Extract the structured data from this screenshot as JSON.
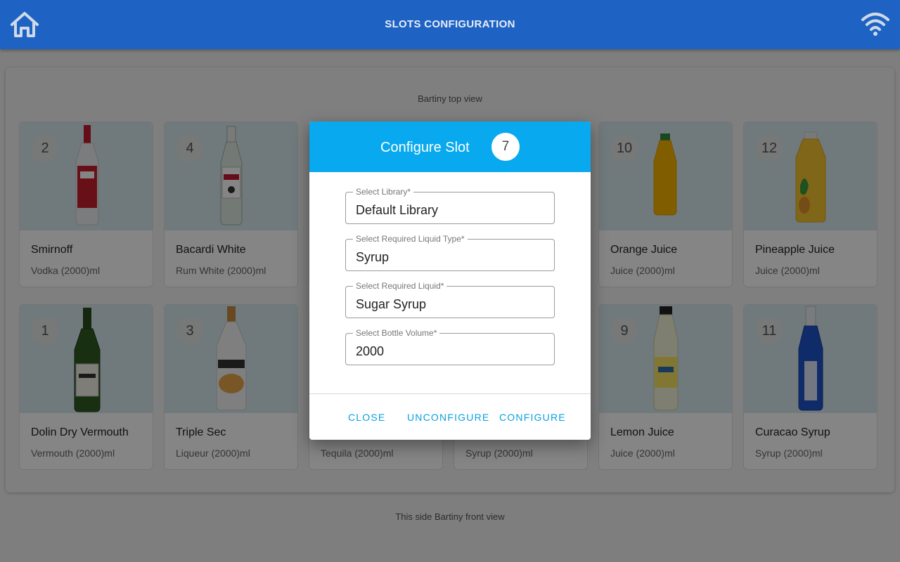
{
  "appbar": {
    "title": "SLOTS CONFIGURATION",
    "home_icon": "home-icon",
    "wifi_icon": "wifi-icon",
    "color": "#1e63c4"
  },
  "captions": {
    "top": "Bartiny top view",
    "bottom": "This side Bartiny front view"
  },
  "slots": [
    {
      "number": "2",
      "name": "Smirnoff",
      "detail": "Vodka (2000)ml",
      "bottle": "smirnoff"
    },
    {
      "number": "4",
      "name": "Bacardi White",
      "detail": "Rum White (2000)ml",
      "bottle": "bacardi"
    },
    {
      "number": "10",
      "name": "Orange Juice",
      "detail": "Juice (2000)ml",
      "bottle": "orange"
    },
    {
      "number": "12",
      "name": "Pineapple Juice",
      "detail": "Juice (2000)ml",
      "bottle": "pineapple"
    },
    {
      "number": "1",
      "name": "Dolin Dry Vermouth",
      "detail": "Vermouth (2000)ml",
      "bottle": "dolin"
    },
    {
      "number": "3",
      "name": "Triple Sec",
      "detail": "Liqueur (2000)ml",
      "bottle": "triplesec"
    },
    {
      "number": "",
      "name": "",
      "detail": "Tequila (2000)ml",
      "bottle": ""
    },
    {
      "number": "",
      "name": "",
      "detail": "Syrup (2000)ml",
      "bottle": ""
    },
    {
      "number": "9",
      "name": "Lemon Juice",
      "detail": "Juice (2000)ml",
      "bottle": "lemon"
    },
    {
      "number": "11",
      "name": "Curacao Syrup",
      "detail": "Syrup (2000)ml",
      "bottle": "curacao"
    }
  ],
  "dialog": {
    "title": "Configure Slot",
    "slot_number": "7",
    "header_color": "#08a9ef",
    "fields": [
      {
        "label": "Select Library*",
        "value": "Default Library"
      },
      {
        "label": "Select Required Liquid Type*",
        "value": "Syrup"
      },
      {
        "label": "Select Required Liquid*",
        "value": "Sugar Syrup"
      },
      {
        "label": "Select Bottle Volume*",
        "value": "2000"
      }
    ],
    "buttons": {
      "close": "CLOSE",
      "unconfigure": "UNCONFIGURE",
      "configure": "CONFIGURE"
    }
  }
}
